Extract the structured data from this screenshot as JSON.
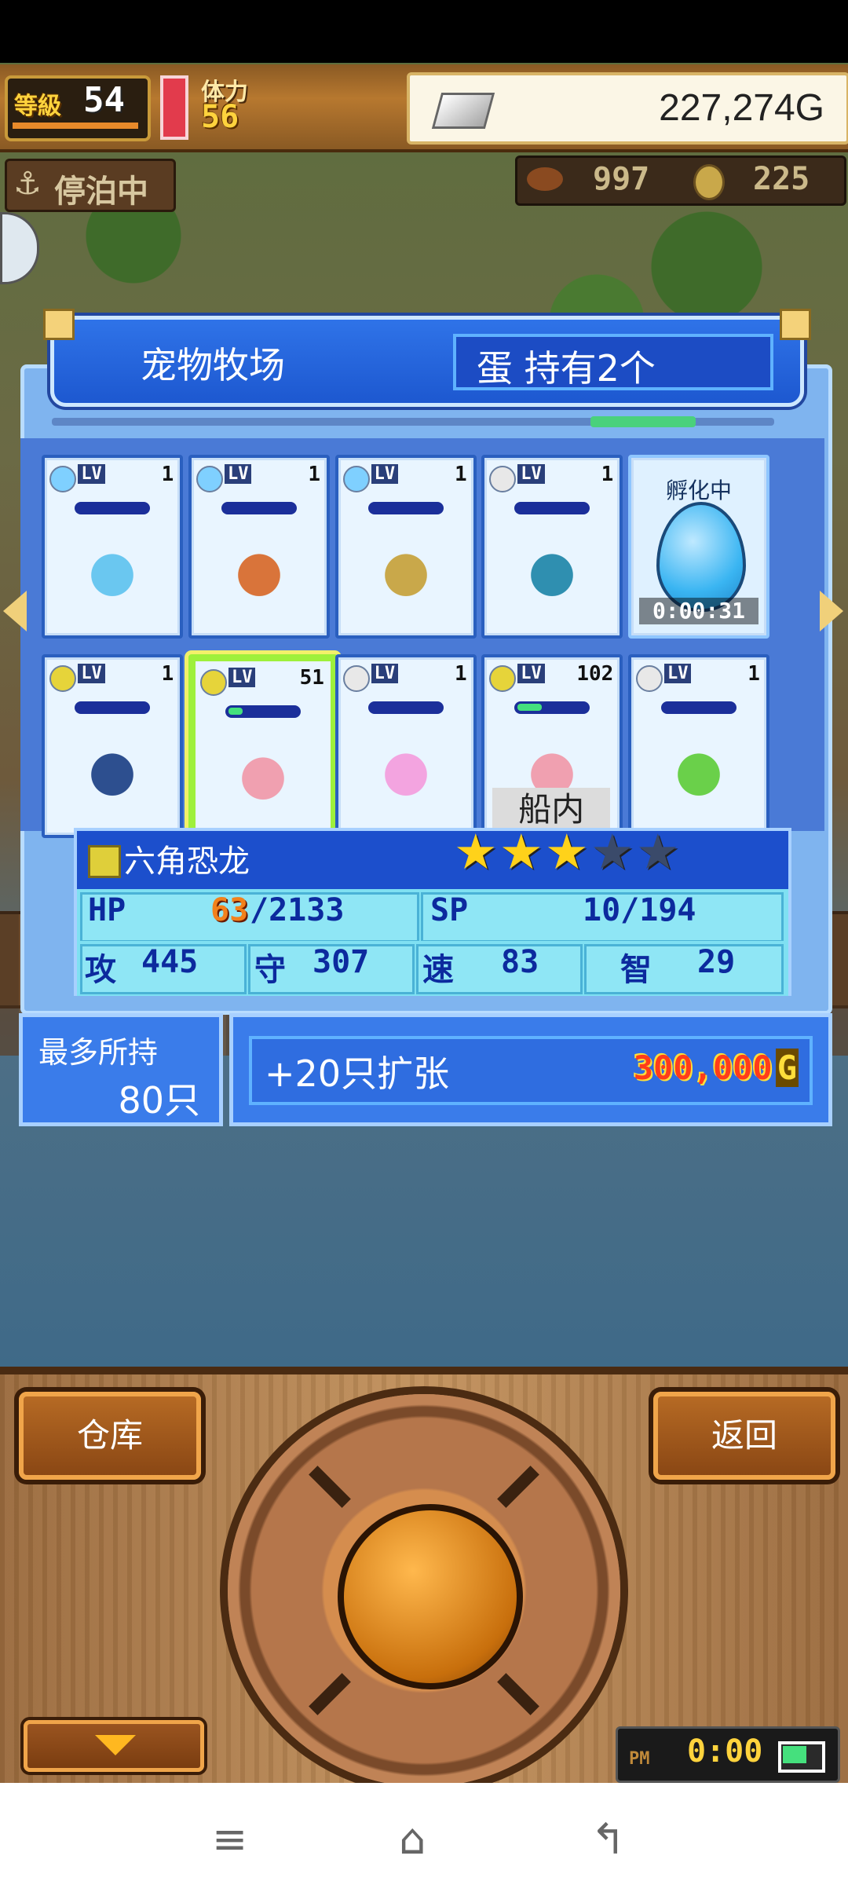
{
  "hud": {
    "level_label": "等級",
    "level": "54",
    "stamina_label": "体力",
    "stamina": "56",
    "gold": "227,274G",
    "dock_status": "停泊中",
    "res1": "997",
    "res2": "225"
  },
  "window": {
    "title": "宠物牧场",
    "egg_count": "蛋 持有2个"
  },
  "pets": [
    {
      "lv_label": "LV",
      "lv": "1",
      "elem": "water",
      "bar": 0,
      "name": "slime"
    },
    {
      "lv_label": "LV",
      "lv": "1",
      "elem": "water",
      "bar": 0,
      "name": "squid"
    },
    {
      "lv_label": "LV",
      "lv": "1",
      "elem": "water",
      "bar": 0,
      "name": "clam"
    },
    {
      "lv_label": "LV",
      "lv": "1",
      "elem": "neutral",
      "bar": 0,
      "name": "snake"
    },
    {
      "egg": true,
      "egg_label": "孵化中",
      "timer": "0:00:31"
    },
    {
      "lv_label": "LV",
      "lv": "1",
      "elem": "thunder",
      "bar": 0,
      "name": "gargoyle"
    },
    {
      "lv_label": "LV",
      "lv": "51",
      "elem": "thunder",
      "bar": 0.2,
      "name": "axolotl",
      "selected": true
    },
    {
      "lv_label": "LV",
      "lv": "1",
      "elem": "neutral",
      "bar": 0,
      "name": "bunny"
    },
    {
      "lv_label": "LV",
      "lv": "102",
      "elem": "thunder",
      "bar": 0.35,
      "name": "axolotl-ship",
      "ship_note": "船内"
    },
    {
      "lv_label": "LV",
      "lv": "1",
      "elem": "neutral",
      "bar": 0,
      "name": "green-slime"
    }
  ],
  "selected_pet": {
    "name": "六角恐龙",
    "stars_filled": 3,
    "stars_total": 5,
    "hp_label": "HP",
    "hp_cur": "63",
    "hp_max": "/2133",
    "sp_label": "SP",
    "sp": "10/194",
    "atk_label": "攻",
    "atk": "445",
    "def_label": "守",
    "def": "307",
    "spd_label": "速",
    "spd": "83",
    "int_label": "智",
    "int": "29"
  },
  "capacity": {
    "label": "最多所持",
    "value": "80只"
  },
  "expand": {
    "label": "+20只扩张",
    "price": "300,000",
    "currency": "G"
  },
  "controls": {
    "warehouse": "仓库",
    "back": "返回"
  },
  "clock": {
    "ampm": "PM",
    "time": "0:00"
  },
  "colors": {
    "accent": "#1c4fcc",
    "gold": "#ffd33d",
    "selection": "#9ef03b"
  }
}
